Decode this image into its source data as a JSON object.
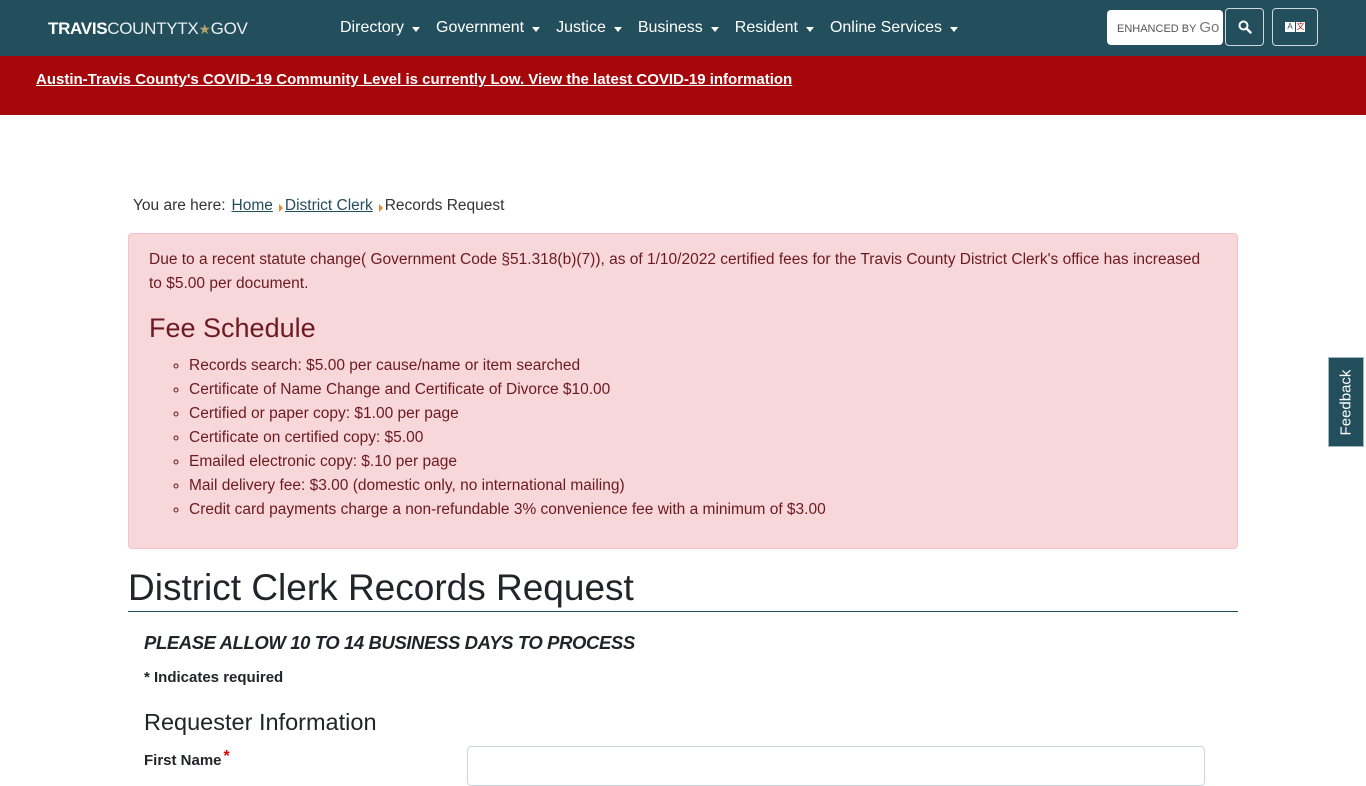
{
  "header": {
    "logo": {
      "part1": "TRAVIS",
      "part2": "COUNTYTX",
      "star": "★",
      "part3": "GOV"
    },
    "nav": [
      {
        "label": "Directory"
      },
      {
        "label": "Government"
      },
      {
        "label": "Justice"
      },
      {
        "label": "Business"
      },
      {
        "label": "Resident"
      },
      {
        "label": "Online Services"
      }
    ],
    "search": {
      "placeholder": "ENHANCED BY Google",
      "placeholder_visible": "ENHANCED BY ",
      "brand": "Go"
    },
    "search_button_icon": "search-icon",
    "translate_button_icon": "translate-icon",
    "translate_glyph": {
      "left": "A",
      "right": "文"
    }
  },
  "covid_banner": {
    "text": "Austin-Travis County's COVID-19 Community Level is currently Low. View the latest COVID-19 information",
    "color": "#a6070a"
  },
  "breadcrumb": {
    "label": "You are here:",
    "items": [
      {
        "label": "Home",
        "link": true
      },
      {
        "label": "District Clerk",
        "link": true
      },
      {
        "label": "Records Request",
        "link": false
      }
    ]
  },
  "alert": {
    "intro": "Due to a recent statute change( Government Code §51.318(b)(7)), as of 1/10/2022 certified fees for the Travis County District Clerk's office has increased to $5.00 per document.",
    "heading": "Fee Schedule",
    "fees": [
      "Records search: $5.00 per cause/name or item searched",
      "Certificate of Name Change and Certificate of Divorce $10.00",
      "Certified or paper copy: $1.00 per page",
      "Certificate on certified copy: $5.00",
      "Emailed electronic copy: $.10 per page",
      "Mail delivery fee: $3.00 (domestic only, no international mailing)",
      "Credit card payments charge a non-refundable 3% convenience fee with a minimum of $3.00"
    ]
  },
  "main": {
    "title": "District Clerk Records Request",
    "notice": "PLEASE ALLOW 10 TO 14 BUSINESS DAYS TO PROCESS",
    "required_note": "* Indicates required",
    "section_heading": "Requester Information",
    "fields": [
      {
        "label": "First Name",
        "required_mark": "*",
        "value": ""
      }
    ]
  },
  "feedback_tab": {
    "label": "Feedback"
  },
  "colors": {
    "brand": "#234e5c",
    "alert_bg": "#f8d7da",
    "accent": "#e8892b"
  }
}
